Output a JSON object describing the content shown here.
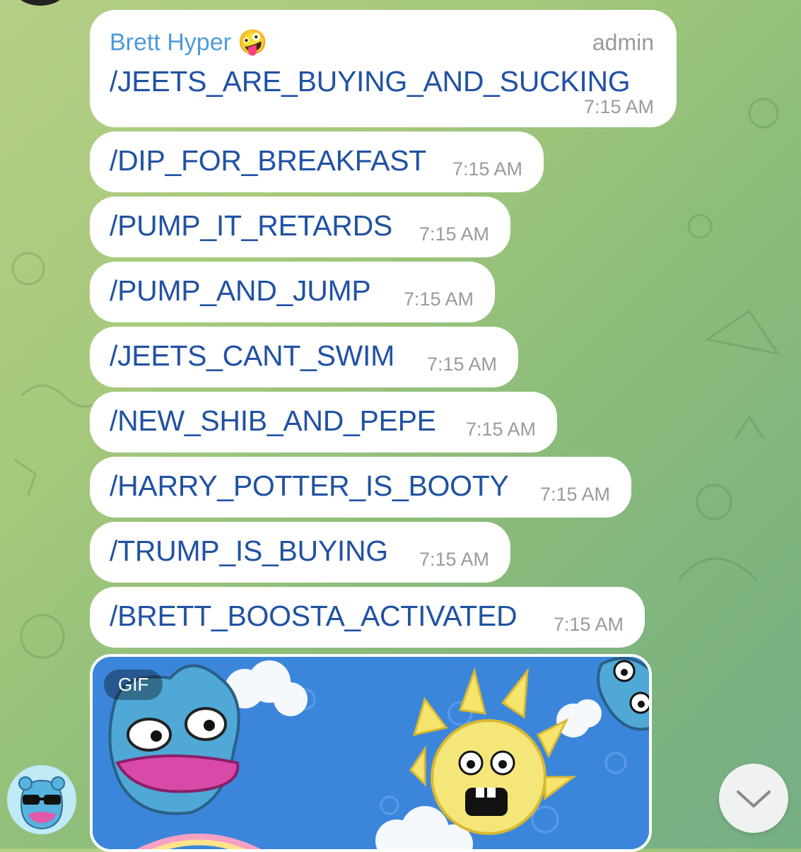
{
  "header_message": {
    "sender": "Brett Hyper 🤪",
    "role": "admin",
    "command": "/JEETS_ARE_BUYING_AND_SUCKING",
    "time": "7:15 AM"
  },
  "messages": [
    {
      "command": "/DIP_FOR_BREAKFAST",
      "time": "7:15 AM"
    },
    {
      "command": "/PUMP_IT_RETARDS",
      "time": "7:15 AM"
    },
    {
      "command": "/PUMP_AND_JUMP",
      "time": "7:15 AM"
    },
    {
      "command": "/JEETS_CANT_SWIM",
      "time": "7:15 AM"
    },
    {
      "command": "/NEW_SHIB_AND_PEPE",
      "time": "7:15 AM"
    },
    {
      "command": "/HARRY_POTTER_IS_BOOTY",
      "time": "7:15 AM"
    },
    {
      "command": "/TRUMP_IS_BUYING",
      "time": "7:15 AM"
    },
    {
      "command": "/BRETT_BOOSTA_ACTIVATED",
      "time": "7:15 AM"
    }
  ],
  "media": {
    "badge": "GIF"
  },
  "icons": {
    "scroll": "chevron-down-icon",
    "avatar": "user-avatar"
  },
  "colors": {
    "command": "#2152a3",
    "sender": "#4e9bdc",
    "time": "#9a9a9a"
  }
}
